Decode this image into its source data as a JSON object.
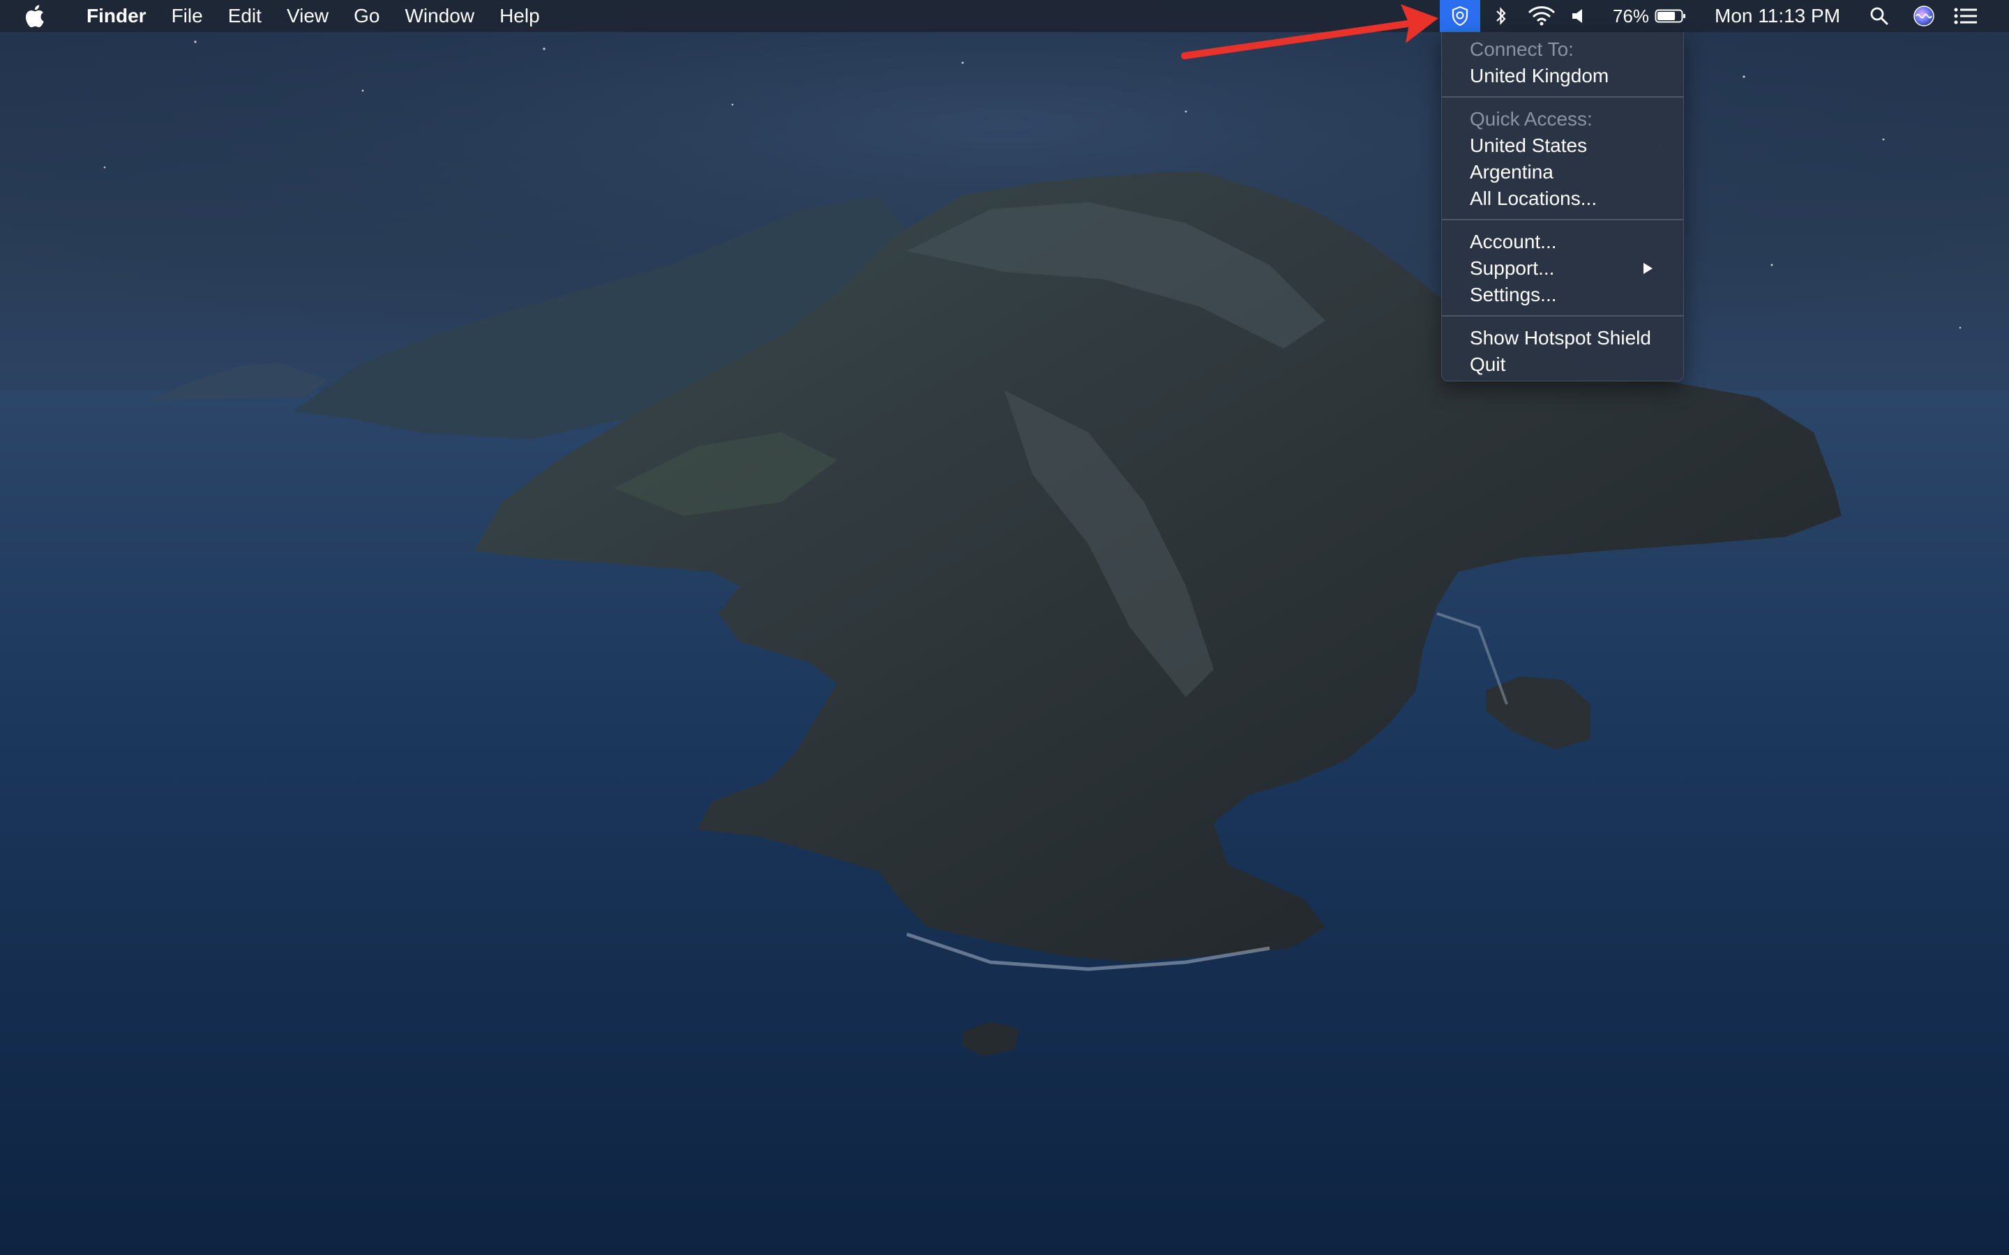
{
  "menubar": {
    "apple_icon": "apple-logo-icon",
    "items": [
      {
        "label": "Finder",
        "bold": true
      },
      {
        "label": "File"
      },
      {
        "label": "Edit"
      },
      {
        "label": "View"
      },
      {
        "label": "Go"
      },
      {
        "label": "Window"
      },
      {
        "label": "Help"
      }
    ],
    "status": {
      "hotspot_shield_icon": "shield-icon",
      "bluetooth_icon": "bluetooth-icon",
      "wifi_icon": "wifi-icon",
      "volume_icon": "volume-icon",
      "battery_percent": "76%",
      "battery_level": 0.76,
      "battery_icon": "battery-icon",
      "clock": "Mon 11:13 PM",
      "spotlight_icon": "search-icon",
      "siri_icon": "siri-icon",
      "notification_icon": "list-icon"
    },
    "accent_color": "#2b6ff0"
  },
  "hs_menu": {
    "connect_header": "Connect To:",
    "connect_location": "United Kingdom",
    "quick_header": "Quick Access:",
    "quick_items": [
      "United States",
      "Argentina",
      "All Locations..."
    ],
    "account": "Account...",
    "support": "Support...",
    "settings": "Settings...",
    "show_app": "Show Hotspot Shield",
    "quit": "Quit"
  },
  "annotation": {
    "arrow_color": "#e8322a"
  }
}
